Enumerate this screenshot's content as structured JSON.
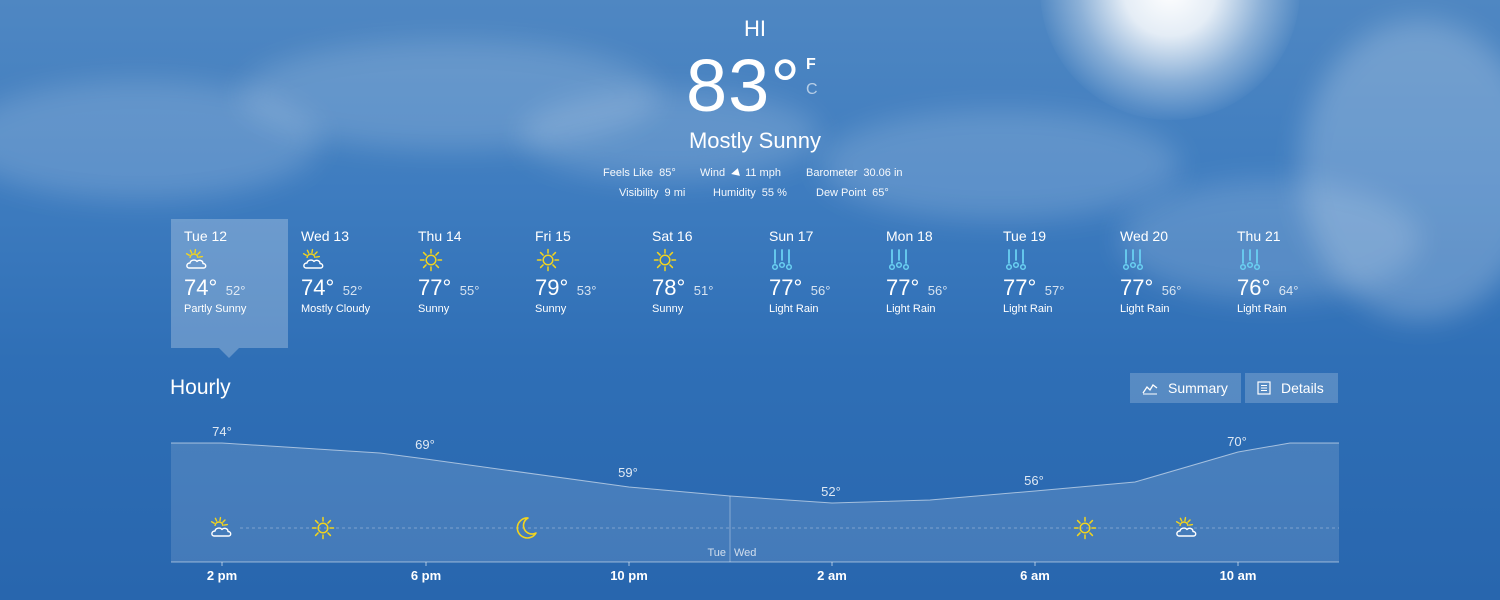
{
  "current": {
    "location": "HI",
    "temperature": "83",
    "degree_symbol": "°",
    "unit_f": "F",
    "unit_c": "C",
    "condition": "Mostly Sunny",
    "feels_like_label": "Feels Like",
    "feels_like": "85°",
    "wind_label": "Wind",
    "wind": "11 mph",
    "barometer_label": "Barometer",
    "barometer": "30.06 in",
    "visibility_label": "Visibility",
    "visibility": "9 mi",
    "humidity_label": "Humidity",
    "humidity": "55 %",
    "dew_point_label": "Dew Point",
    "dew_point": "65°"
  },
  "daily": [
    {
      "name": "Tue 12",
      "hi": "74°",
      "lo": "52°",
      "condition": "Partly Sunny",
      "icon": "partly-sunny-icon",
      "selected": true
    },
    {
      "name": "Wed 13",
      "hi": "74°",
      "lo": "52°",
      "condition": "Mostly Cloudy",
      "icon": "partly-sunny-icon"
    },
    {
      "name": "Thu 14",
      "hi": "77°",
      "lo": "55°",
      "condition": "Sunny",
      "icon": "sun-icon"
    },
    {
      "name": "Fri 15",
      "hi": "79°",
      "lo": "53°",
      "condition": "Sunny",
      "icon": "sun-icon"
    },
    {
      "name": "Sat 16",
      "hi": "78°",
      "lo": "51°",
      "condition": "Sunny",
      "icon": "sun-icon"
    },
    {
      "name": "Sun 17",
      "hi": "77°",
      "lo": "56°",
      "condition": "Light Rain",
      "icon": "rain-icon"
    },
    {
      "name": "Mon 18",
      "hi": "77°",
      "lo": "56°",
      "condition": "Light Rain",
      "icon": "rain-icon"
    },
    {
      "name": "Tue 19",
      "hi": "77°",
      "lo": "57°",
      "condition": "Light Rain",
      "icon": "rain-icon"
    },
    {
      "name": "Wed 20",
      "hi": "77°",
      "lo": "56°",
      "condition": "Light Rain",
      "icon": "rain-icon"
    },
    {
      "name": "Thu 21",
      "hi": "76°",
      "lo": "64°",
      "condition": "Light Rain",
      "icon": "rain-icon"
    }
  ],
  "hourly": {
    "title": "Hourly",
    "summary_label": "Summary",
    "details_label": "Details",
    "time_labels": [
      "2 pm",
      "6 pm",
      "10 pm",
      "2 am",
      "6 am",
      "10 am"
    ],
    "temp_labels": [
      "74°",
      "69°",
      "59°",
      "52°",
      "56°",
      "70°"
    ],
    "day_left": "Tue",
    "day_right": "Wed",
    "condition_icons": [
      "partly-sunny-icon",
      "sun-icon",
      "moon-icon",
      "sun-icon",
      "partly-sunny-icon"
    ]
  },
  "colors": {
    "sun_yellow": "#f2d41e",
    "rain_blue": "#6ad0f2",
    "sky_blue": "#3f7dc0"
  }
}
